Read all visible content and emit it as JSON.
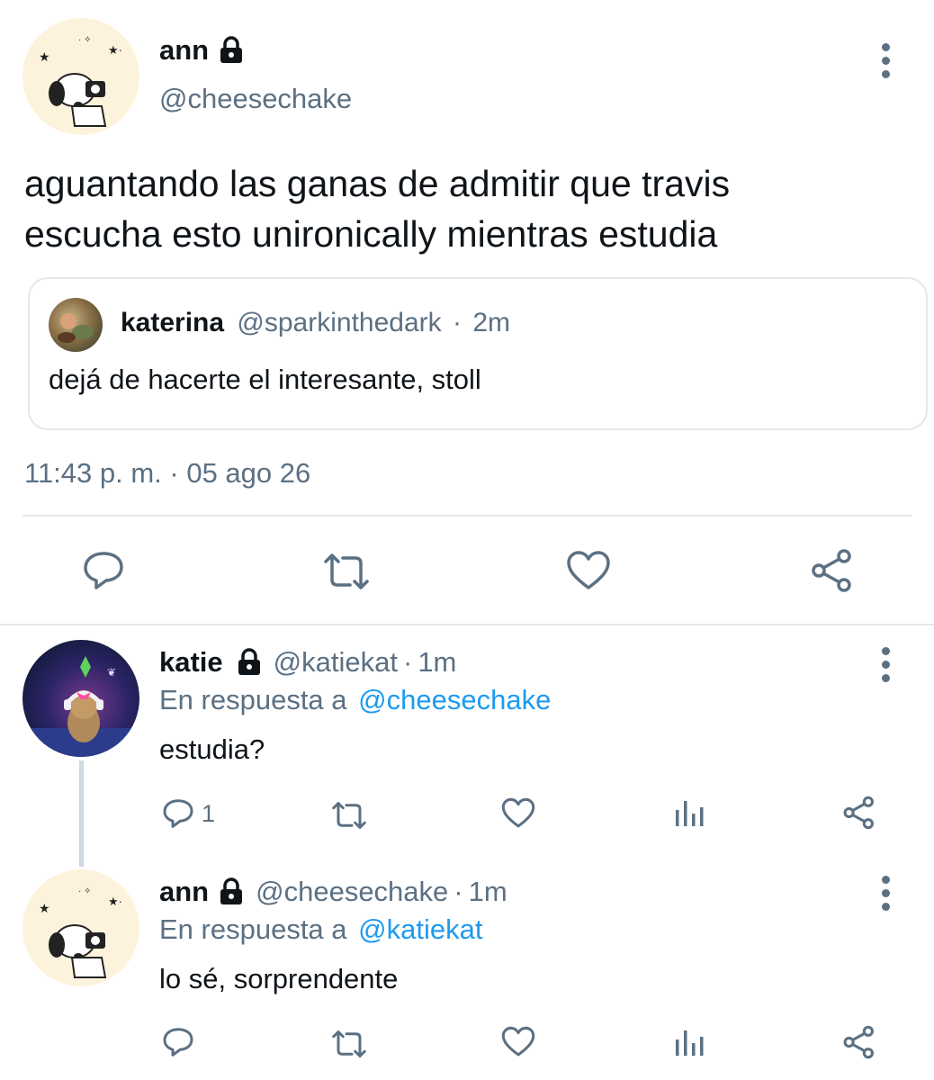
{
  "main_tweet": {
    "author_name": "ann",
    "handle": "@cheesechake",
    "text_line1": "aguantando las ganas de admitir que travis",
    "text_line2": "escucha esto unironically mientras estudia",
    "timestamp": "11:43 p. m. · 05 ago 26",
    "quoted": {
      "author_name": "katerina",
      "handle": "@sparkinthedark",
      "sep": "·",
      "time": "2m",
      "text": "dejá de hacerte el interesante, stoll"
    }
  },
  "replies": [
    {
      "author_name": "katie",
      "handle": "@katiekat",
      "sep": "·",
      "time": "1m",
      "reply_prefix": "En respuesta a",
      "reply_to": "@cheesechake",
      "text": "estudia?",
      "reply_count": "1"
    },
    {
      "author_name": "ann",
      "handle": "@cheesechake",
      "sep": "·",
      "time": "1m",
      "reply_prefix": "En respuesta a",
      "reply_to": "@katiekat",
      "text": "lo sé, sorprendente"
    }
  ],
  "icons": {
    "reply": "reply-icon",
    "retweet": "retweet-icon",
    "like": "heart-icon",
    "share": "share-icon",
    "analytics": "analytics-icon",
    "more": "more-vertical-icon",
    "lock": "lock-icon"
  },
  "colors": {
    "text": "#0f1419",
    "muted": "#5b7083",
    "link": "#1d9bf0",
    "divider": "#e1e8ed"
  }
}
